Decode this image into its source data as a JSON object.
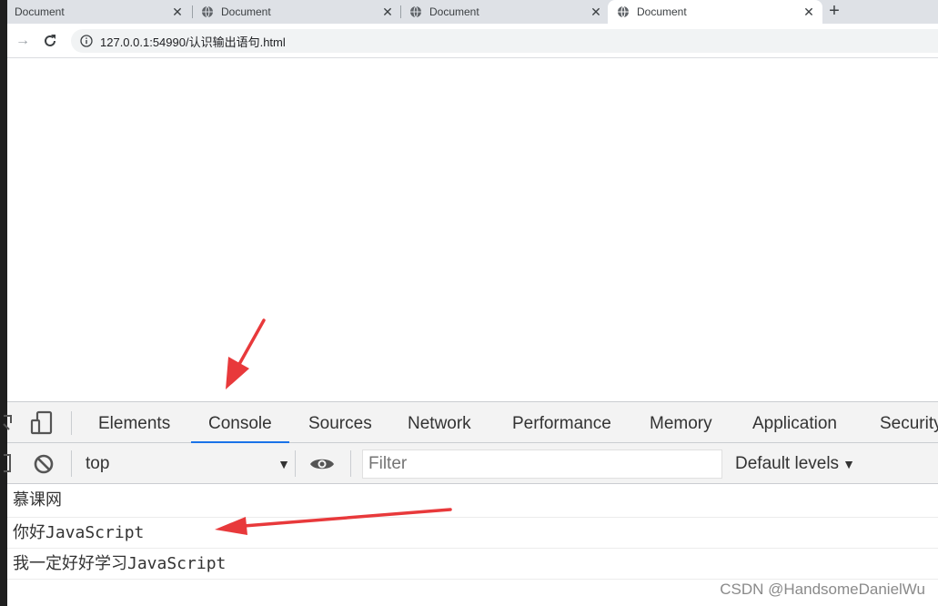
{
  "browser": {
    "tabs": [
      {
        "title": "Document",
        "active": false
      },
      {
        "title": "Document",
        "active": false
      },
      {
        "title": "Document",
        "active": false
      },
      {
        "title": "Document",
        "active": true
      }
    ],
    "url": "127.0.0.1:54990/认识输出语句.html"
  },
  "devtools": {
    "tabs": [
      "Elements",
      "Console",
      "Sources",
      "Network",
      "Performance",
      "Memory",
      "Application",
      "Security"
    ],
    "active_tab": "Console",
    "context": "top",
    "filter_placeholder": "Filter",
    "levels": "Default levels"
  },
  "console": {
    "lines": [
      "慕课网",
      "你好JavaScript",
      "我一定好好学习JavaScript"
    ]
  },
  "watermark": "CSDN @HandsomeDanielWu",
  "colors": {
    "accent": "#1a73e8",
    "annotation_arrow": "#e8393b"
  }
}
